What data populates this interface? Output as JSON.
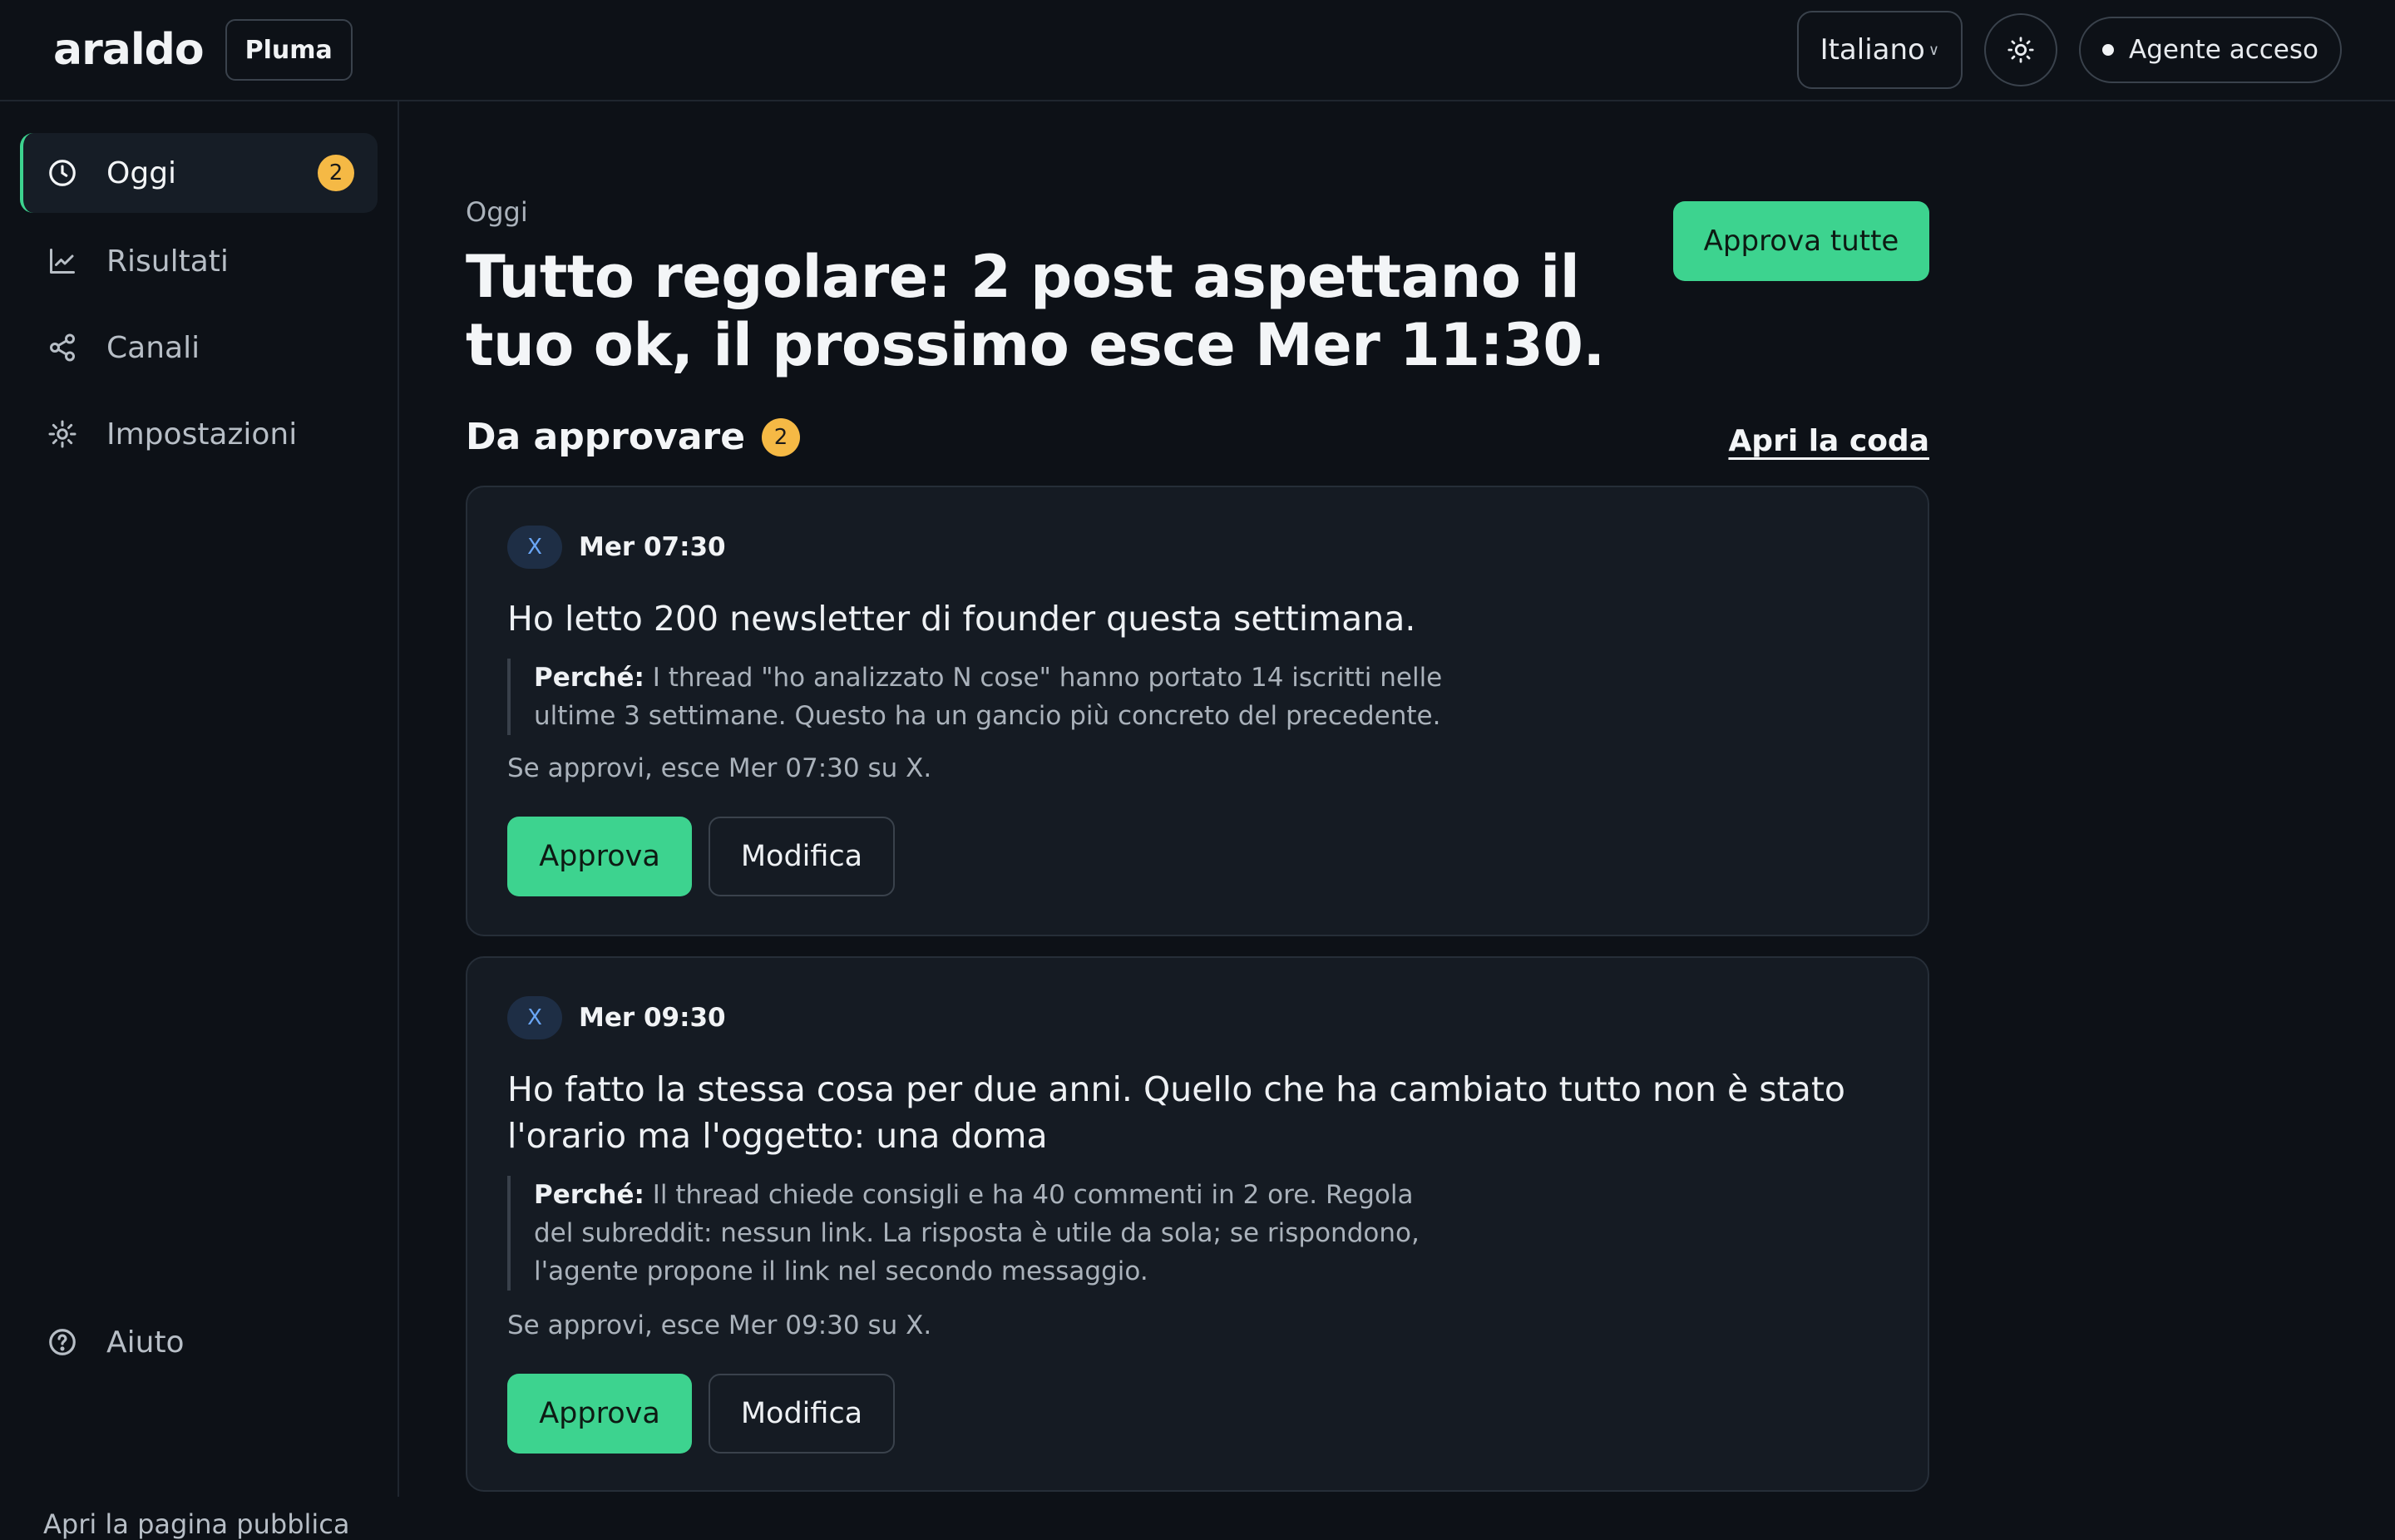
{
  "app": {
    "logo": "araldo",
    "workspace": "Pluma",
    "language": "Italiano",
    "agent_status": "Agente acceso"
  },
  "sidebar": {
    "items": [
      {
        "label": "Oggi",
        "icon": "clock-icon",
        "badge": "2",
        "active": true
      },
      {
        "label": "Risultati",
        "icon": "chart-icon"
      },
      {
        "label": "Canali",
        "icon": "share-icon"
      },
      {
        "label": "Impostazioni",
        "icon": "gear-icon"
      }
    ],
    "help": "Aiuto",
    "public_page": "Apri la pagina pubblica"
  },
  "main": {
    "eyebrow": "Oggi",
    "headline": "Tutto regolare: 2 post aspettano il tuo ok, il prossimo esce Mer 11:30.",
    "approve_all": "Approva tutte",
    "section_title": "Da approvare",
    "section_badge": "2",
    "queue_link": "Apri la coda"
  },
  "posts": [
    {
      "channel": "X",
      "time": "Mer 07:30",
      "text": "Ho letto 200 newsletter di founder questa settimana.",
      "why_label": "Perché:",
      "why": " I thread \"ho analizzato N cose\" hanno portato 14 iscritti nelle ultime 3 settimane. Questo ha un gancio più concreto del precedente.",
      "schedule": "Se approvi, esce Mer 07:30 su X.",
      "approve": "Approva",
      "edit": "Modifica"
    },
    {
      "channel": "X",
      "time": "Mer 09:30",
      "text": "Ho fatto la stessa cosa per due anni. Quello che ha cambiato tutto non è stato l'orario ma l'oggetto: una doma",
      "why_label": "Perché:",
      "why": " Il thread chiede consigli e ha 40 commenti in 2 ore. Regola del subreddit: nessun link. La risposta è utile da sola; se rispondono, l'agente propone il link nel secondo messaggio.",
      "schedule": "Se approvi, esce Mer 09:30 su X.",
      "approve": "Approva",
      "edit": "Modifica"
    }
  ],
  "colors": {
    "background": "#0d1117",
    "accent": "#3dd38f",
    "badge": "#f5b945"
  }
}
